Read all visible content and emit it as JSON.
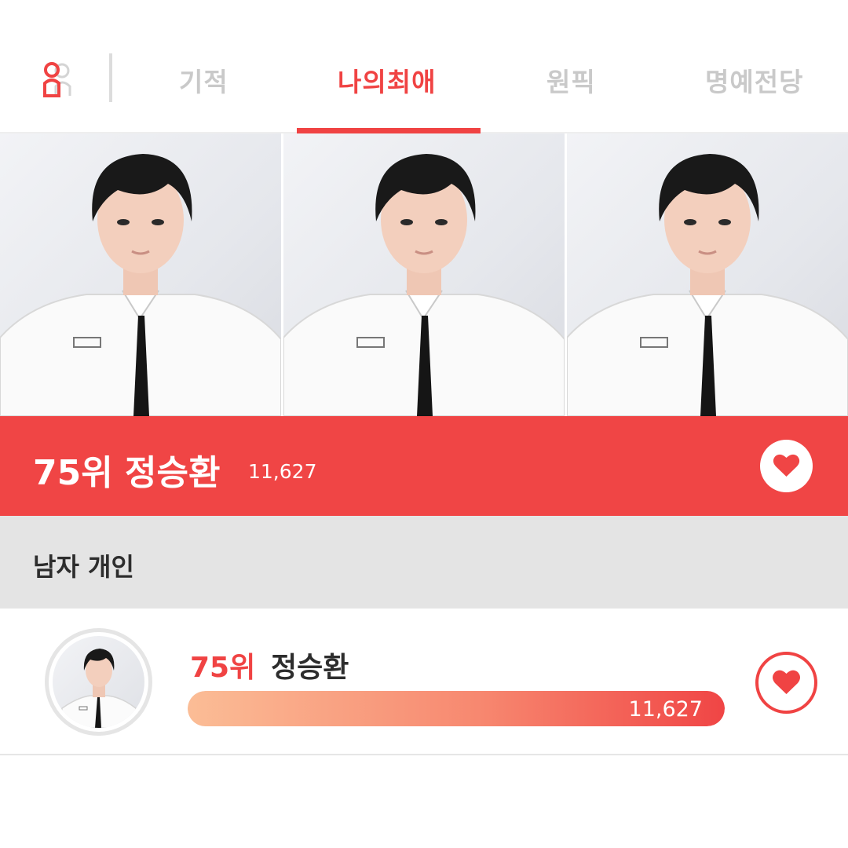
{
  "tabs": [
    {
      "label": "기적",
      "active": false
    },
    {
      "label": "나의최애",
      "active": true
    },
    {
      "label": "원픽",
      "active": false
    },
    {
      "label": "명예전당",
      "active": false
    }
  ],
  "banner": {
    "rank_label": "75위 정승환",
    "score": "11,627"
  },
  "category": {
    "title": "남자 개인"
  },
  "list": [
    {
      "rank": "75위",
      "name": "정승환",
      "score": "11,627",
      "progress_fraction": 1.0
    }
  ],
  "colors": {
    "accent": "#f04343",
    "banner_bg": "#f04545",
    "category_bg": "#e4e4e4",
    "tab_inactive": "#c9c9c9"
  },
  "icons": {
    "profile": "user-profile-icon",
    "favorite": "heart-icon"
  }
}
